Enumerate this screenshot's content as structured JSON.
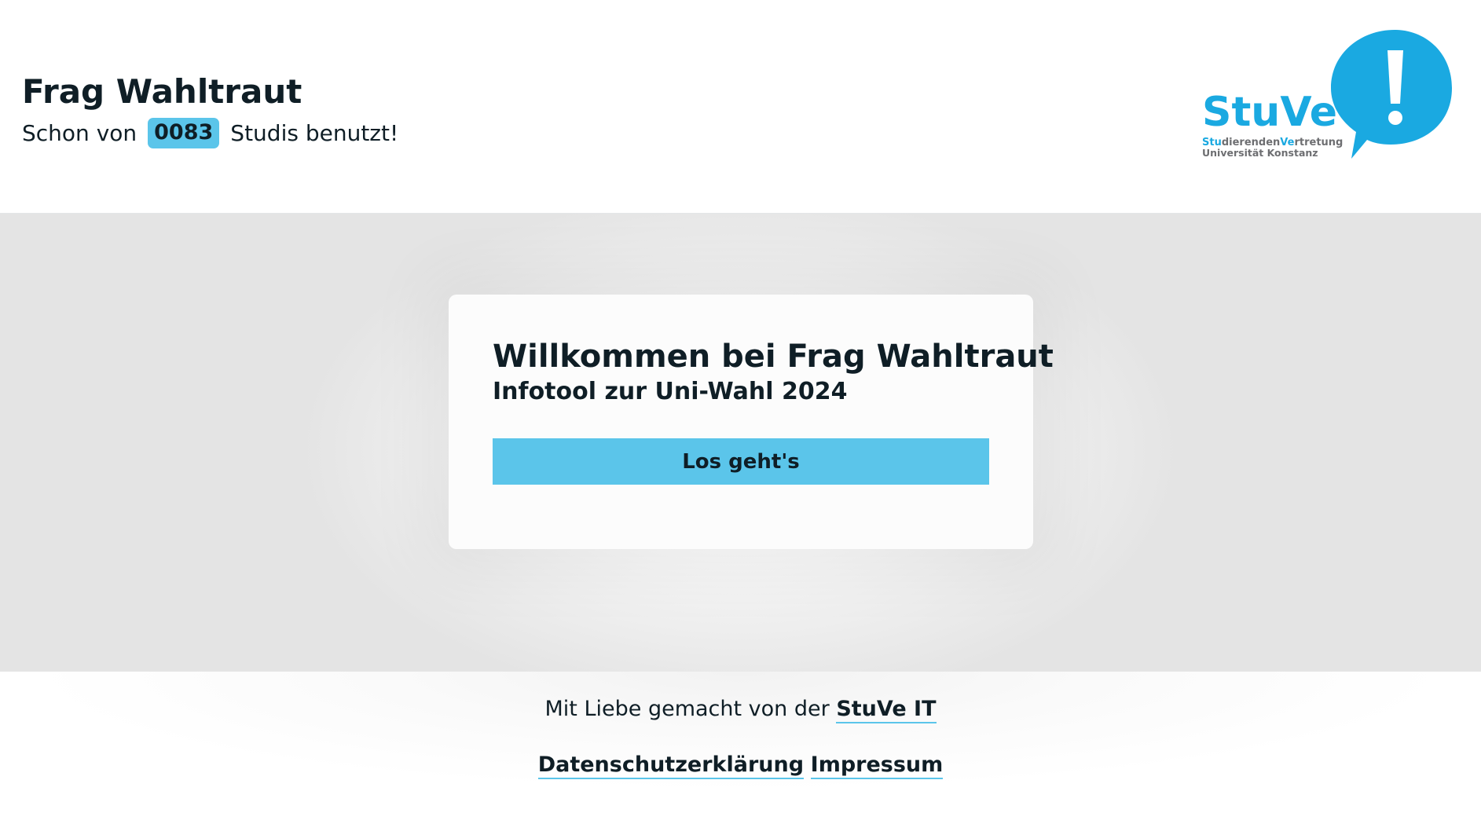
{
  "header": {
    "title": "Frag Wahltraut",
    "subtitle_prefix": "Schon von",
    "counter": "0083",
    "subtitle_suffix": "Studis benutzt!"
  },
  "logo": {
    "wordmark": "StuVe",
    "line1_prefix": "Stu",
    "line1_mid": "dierenden",
    "line1_ve": "Ve",
    "line1_suffix": "rtretung",
    "line2": "Universität Konstanz",
    "exclamation": "!",
    "colors": {
      "blue": "#1aa9e1",
      "gray": "#6d6e71"
    }
  },
  "card": {
    "title": "Willkommen bei Frag Wahltraut",
    "subtitle": "Infotool zur Uni-Wahl 2024",
    "button_label": "Los geht's"
  },
  "footer": {
    "made_by_prefix": "Mit Liebe gemacht von der",
    "made_by_link": "StuVe IT",
    "privacy_link": "Datenschutzerklärung",
    "imprint_link": "Impressum"
  },
  "colors": {
    "accent": "#5bc5ea",
    "text": "#0f1e26"
  }
}
